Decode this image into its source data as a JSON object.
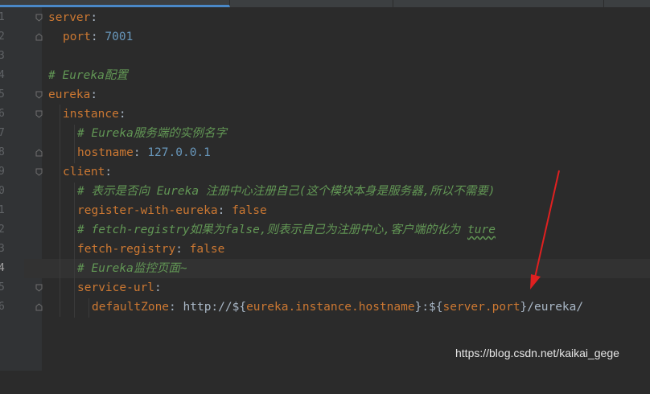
{
  "colors": {
    "background": "#2b2b2b",
    "gutter": "#313335",
    "key": "#cc7832",
    "plain": "#a9b7c6",
    "number": "#6897bb",
    "comment": "#629755",
    "arrow": "#e02020"
  },
  "editor": {
    "lines": [
      {
        "num": "1",
        "key": "server",
        "colon": ":"
      },
      {
        "num": "2",
        "key": "port",
        "colon": ":",
        "value": "7001"
      },
      {
        "num": "3"
      },
      {
        "num": "4",
        "comment": "# Eureka配置"
      },
      {
        "num": "5",
        "key": "eureka",
        "colon": ":"
      },
      {
        "num": "6",
        "key": "instance",
        "colon": ":"
      },
      {
        "num": "7",
        "comment": "# Eureka服务端的实例名字"
      },
      {
        "num": "8",
        "key": "hostname",
        "colon": ":",
        "value": "127.0.0.1"
      },
      {
        "num": "9",
        "key": "client",
        "colon": ":"
      },
      {
        "num": "0",
        "comment": "# 表示是否向 Eureka 注册中心注册自己(这个模块本身是服务器,所以不需要)"
      },
      {
        "num": "1",
        "key": "register-with-eureka",
        "colon": ":",
        "value": "false"
      },
      {
        "num": "2",
        "comment": "# fetch-registry如果为false,则表示自己为注册中心,客户端的化为 ",
        "comment_underlined": "ture"
      },
      {
        "num": "3",
        "key": "fetch-registry",
        "colon": ":",
        "value": "false"
      },
      {
        "num": "4",
        "comment": "# Eureka监控页面~"
      },
      {
        "num": "5",
        "key": "service-url",
        "colon": ":"
      },
      {
        "num": "6",
        "key": "defaultZone",
        "colon": ":",
        "url_a": "http://${",
        "url_b": "eureka.instance.hostname",
        "url_c": "}:${",
        "url_d": "server.port",
        "url_e": "}/eureka/"
      }
    ]
  },
  "watermark": "https://blog.csdn.net/kaikai_gege",
  "icons": [
    "fold-open-icon",
    "fold-close-icon"
  ]
}
